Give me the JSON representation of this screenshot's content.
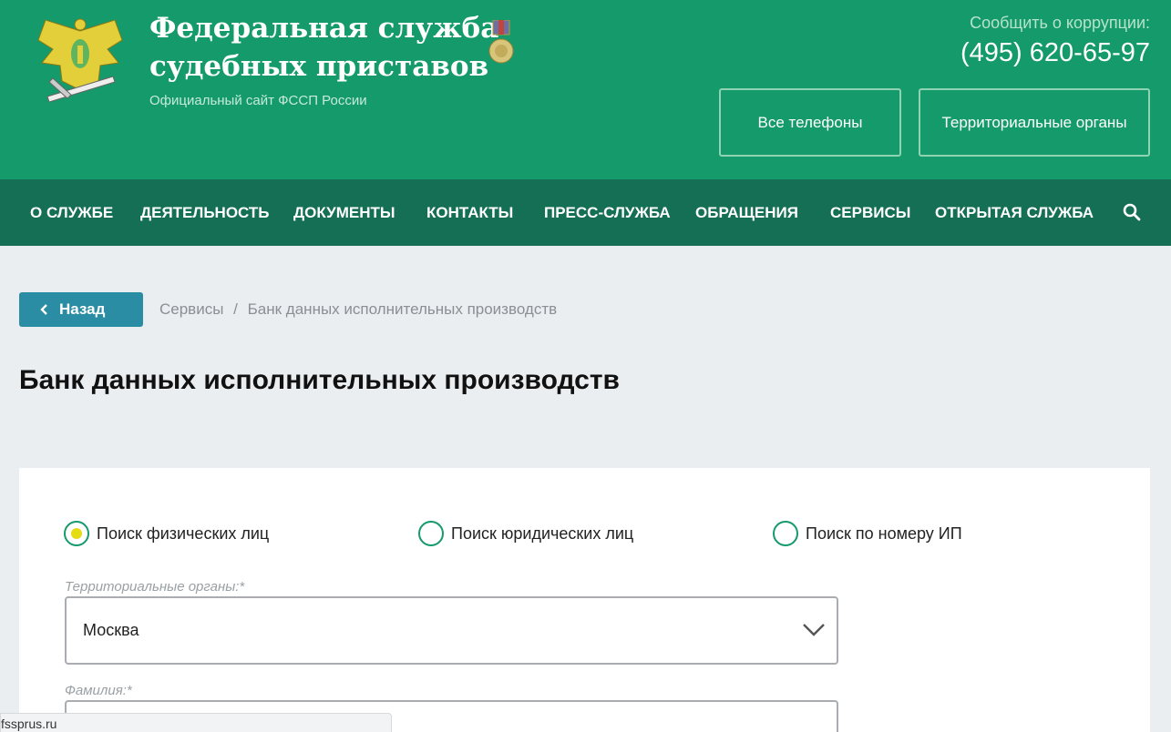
{
  "header": {
    "title_line1": "Федеральная служба",
    "title_line2": "судебных приставов",
    "subtitle": "Официальный сайт ФССП России",
    "corruption_label": "Сообщить о коррупции:",
    "corruption_phone": "(495) 620-65-97",
    "buttons": {
      "phones": "Все телефоны",
      "orgs": "Территориальные органы"
    },
    "emblem_icon": "eagle-emblem-icon",
    "medal_icon": "medal-icon"
  },
  "nav": {
    "items": [
      "О СЛУЖБЕ",
      "ДЕЯТЕЛЬНОСТЬ",
      "ДОКУМЕНТЫ",
      "КОНТАКТЫ",
      "ПРЕСС-СЛУЖБА",
      "ОБРАЩЕНИЯ",
      "СЕРВИСЫ",
      "ОТКРЫТАЯ СЛУЖБА"
    ],
    "search_icon": "search-icon"
  },
  "breadcrumb": {
    "back_label": "Назад",
    "items": [
      "Сервисы",
      "Банк данных исполнительных производств"
    ],
    "separator": "/"
  },
  "page": {
    "title": "Банк данных исполнительных производств"
  },
  "form": {
    "radios": [
      {
        "label": "Поиск физических лиц",
        "checked": true
      },
      {
        "label": "Поиск юридических лиц",
        "checked": false
      },
      {
        "label": "Поиск по номеру ИП",
        "checked": false
      }
    ],
    "region_label": "Территориальные органы:*",
    "region_value": "Москва",
    "surname_label": "Фамилия:*",
    "surname_value": ""
  },
  "status_bar": {
    "url": "fssprus.ru"
  },
  "colors": {
    "header": "#149a6b",
    "nav": "#146f55",
    "back_button": "#2b8da3",
    "radio_dot": "#e6dc14"
  }
}
